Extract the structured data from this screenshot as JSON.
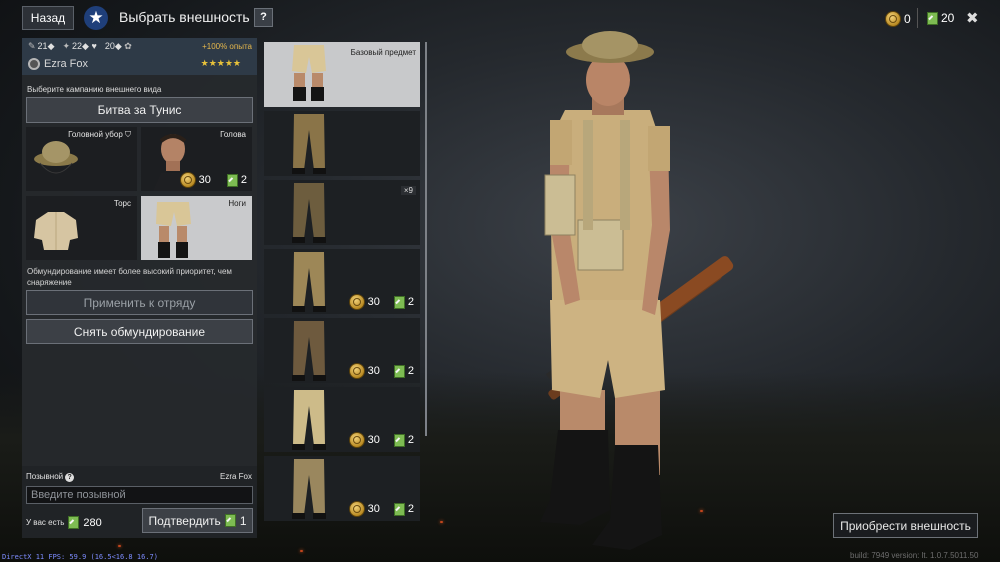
{
  "topbar": {
    "back_label": "Назад",
    "title": "Выбрать внешность",
    "help_label": "?",
    "gold_amount": "0",
    "tickets_amount": "20"
  },
  "soldier": {
    "stat_1": "21",
    "stat_2": "22",
    "stat_3": "20",
    "xp_bonus": "+100% опыта",
    "name": "Ezra Fox",
    "rating": "★★★★★"
  },
  "appearance": {
    "select_campaign_label": "Выберите кампанию внешнего вида",
    "campaign_button": "Битва за Тунис",
    "slots": [
      {
        "label": "Головной убор",
        "price": null,
        "tickets": null
      },
      {
        "label": "Голова",
        "price": "30",
        "tickets": "2"
      },
      {
        "label": "Торс",
        "price": null,
        "tickets": null
      },
      {
        "label": "Ноги",
        "price": null,
        "tickets": null
      }
    ],
    "priority_note": "Обмундирование имеет более высокий приоритет, чем снаряжение",
    "apply_squad_button": "Применить к отряду",
    "remove_uniform_button": "Снять обмундирование"
  },
  "callsign": {
    "label": "Позывной",
    "help": "?",
    "current_name": "Ezra Fox",
    "input_placeholder": "Введите позывной",
    "have_label": "У вас есть",
    "have_amount": "280",
    "confirm_button": "Подтвердить",
    "confirm_cost": "1"
  },
  "items": [
    {
      "label": "Базовый предмет",
      "count": "",
      "price": "",
      "tickets": "",
      "color": "#d9c697"
    },
    {
      "label": "",
      "count": "",
      "price": "",
      "tickets": "",
      "color": "#8a7448"
    },
    {
      "label": "",
      "count": "×9",
      "price": "",
      "tickets": "",
      "color": "#6d5d3e"
    },
    {
      "label": "",
      "count": "",
      "price": "30",
      "tickets": "2",
      "color": "#9d8757"
    },
    {
      "label": "",
      "count": "",
      "price": "30",
      "tickets": "2",
      "color": "#6e5a3e"
    },
    {
      "label": "",
      "count": "",
      "price": "30",
      "tickets": "2",
      "color": "#cdbb89"
    },
    {
      "label": "",
      "count": "",
      "price": "30",
      "tickets": "2",
      "color": "#9a875e"
    }
  ],
  "purchase_button": "Приобрести внешность",
  "build_info": "build: 7949 version: lt. 1.0.7.5011.50",
  "debug_line": "DirectX 11 FPS: 59.9 (16.5<16.8 16.7)"
}
